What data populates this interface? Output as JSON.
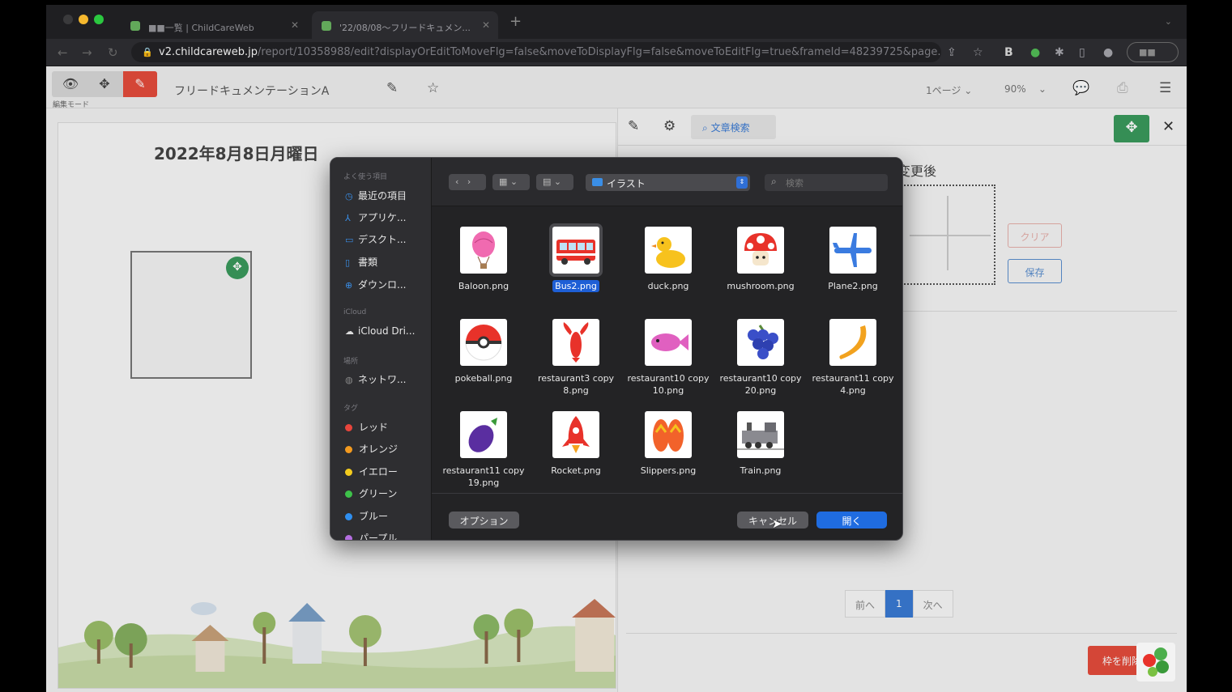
{
  "browser": {
    "tabs": [
      {
        "label": "■■一覧 | ChildCareWeb"
      },
      {
        "label": "'22/08/08〜フリードキュメン..."
      }
    ],
    "new_tab": "+",
    "url_host": "v2.childcareweb.jp",
    "url_path": "/report/10358988/edit?displayOrEditToMoveFlg=false&moveToDisplayFlg=false&moveToEditFlg=true&frameId=48239725&page...",
    "profile_label": "■■"
  },
  "app": {
    "mode_label": "編集モード",
    "doc_title": "フリードキュメンテーションA",
    "page_select": "1ページ",
    "zoom_select": "90%"
  },
  "document": {
    "date": "2022年8月8日月曜日"
  },
  "right_panel": {
    "search_label": "文章検索",
    "after_label": "変更後",
    "clear_label": "クリア",
    "save_label": "保存",
    "pager": {
      "prev": "前へ",
      "current": "1",
      "next": "次へ"
    },
    "delete_label": "枠を削除する"
  },
  "dialog": {
    "sidebar": {
      "favorites_header": "よく使う項目",
      "favorites": [
        {
          "label": "最近の項目",
          "icon": "clock-icon"
        },
        {
          "label": "アプリケ...",
          "icon": "apps-icon"
        },
        {
          "label": "デスクト...",
          "icon": "desktop-icon"
        },
        {
          "label": "書類",
          "icon": "document-icon"
        },
        {
          "label": "ダウンロ...",
          "icon": "download-icon"
        }
      ],
      "icloud_header": "iCloud",
      "icloud": [
        {
          "label": "iCloud Dri...",
          "icon": "cloud-icon"
        }
      ],
      "locations_header": "場所",
      "locations": [
        {
          "label": "ネットワ...",
          "icon": "network-icon"
        }
      ],
      "tags_header": "タグ",
      "tags": [
        {
          "label": "レッド",
          "color": "#e8453c"
        },
        {
          "label": "オレンジ",
          "color": "#f39a1f"
        },
        {
          "label": "イエロー",
          "color": "#f4cc1e"
        },
        {
          "label": "グリーン",
          "color": "#3ec24a"
        },
        {
          "label": "ブルー",
          "color": "#2f8ff0"
        },
        {
          "label": "パープル",
          "color": "#b46ee0"
        }
      ]
    },
    "folder": "イラスト",
    "search_placeholder": "検索",
    "files": [
      {
        "name": "Baloon.png",
        "icon": "balloon-icon",
        "selected": false
      },
      {
        "name": "Bus2.png",
        "icon": "bus-icon",
        "selected": true
      },
      {
        "name": "duck.png",
        "icon": "duck-icon",
        "selected": false
      },
      {
        "name": "mushroom.png",
        "icon": "mushroom-icon",
        "selected": false
      },
      {
        "name": "Plane2.png",
        "icon": "plane-icon",
        "selected": false
      },
      {
        "name": "pokeball.png",
        "icon": "pokeball-icon",
        "selected": false
      },
      {
        "name": "restaurant3 copy 8.png",
        "icon": "lobster-icon",
        "selected": false
      },
      {
        "name": "restaurant10 copy 10.png",
        "icon": "fish-icon",
        "selected": false
      },
      {
        "name": "restaurant10 copy 20.png",
        "icon": "grapes-icon",
        "selected": false
      },
      {
        "name": "restaurant11 copy 4.png",
        "icon": "banana-icon",
        "selected": false
      },
      {
        "name": "restaurant11 copy 19.png",
        "icon": "eggplant-icon",
        "selected": false
      },
      {
        "name": "Rocket.png",
        "icon": "rocket-icon",
        "selected": false
      },
      {
        "name": "Slippers.png",
        "icon": "slippers-icon",
        "selected": false
      },
      {
        "name": "Train.png",
        "icon": "train-icon",
        "selected": false
      }
    ],
    "options_label": "オプション",
    "cancel_label": "キャンセル",
    "open_label": "開く"
  }
}
